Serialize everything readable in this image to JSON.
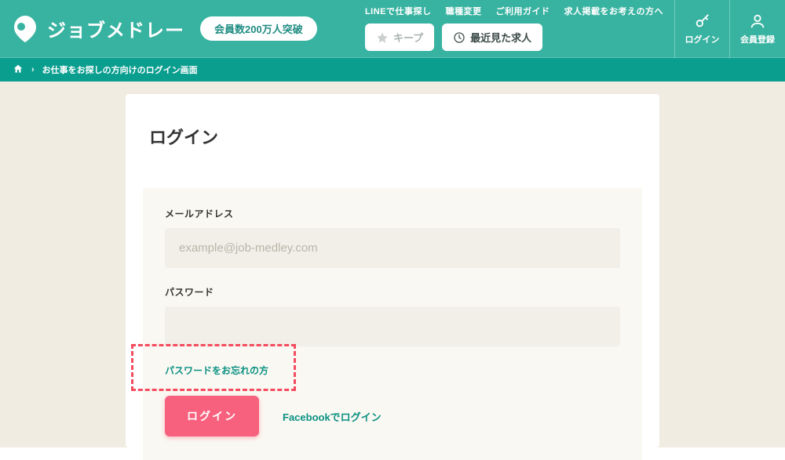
{
  "brand": {
    "name": "ジョブメドレー",
    "badge": "会員数200万人突破"
  },
  "top_nav": {
    "line_search": "LINEで仕事探し",
    "job_change": "職種変更",
    "guide": "ご利用ガイド",
    "employers": "求人掲載をお考えの方へ"
  },
  "header_buttons": {
    "keep": "キープ",
    "recent": "最近見た求人"
  },
  "auth": {
    "login": "ログイン",
    "register": "会員登録"
  },
  "breadcrumb": {
    "current": "お仕事をお探しの方向けのログイン画面"
  },
  "page": {
    "title": "ログイン"
  },
  "form": {
    "email_label": "メールアドレス",
    "email_placeholder": "example@job-medley.com",
    "password_label": "パスワード",
    "forgot": "パスワードをお忘れの方",
    "login_button": "ログイン",
    "facebook_login": "Facebookでログイン"
  }
}
